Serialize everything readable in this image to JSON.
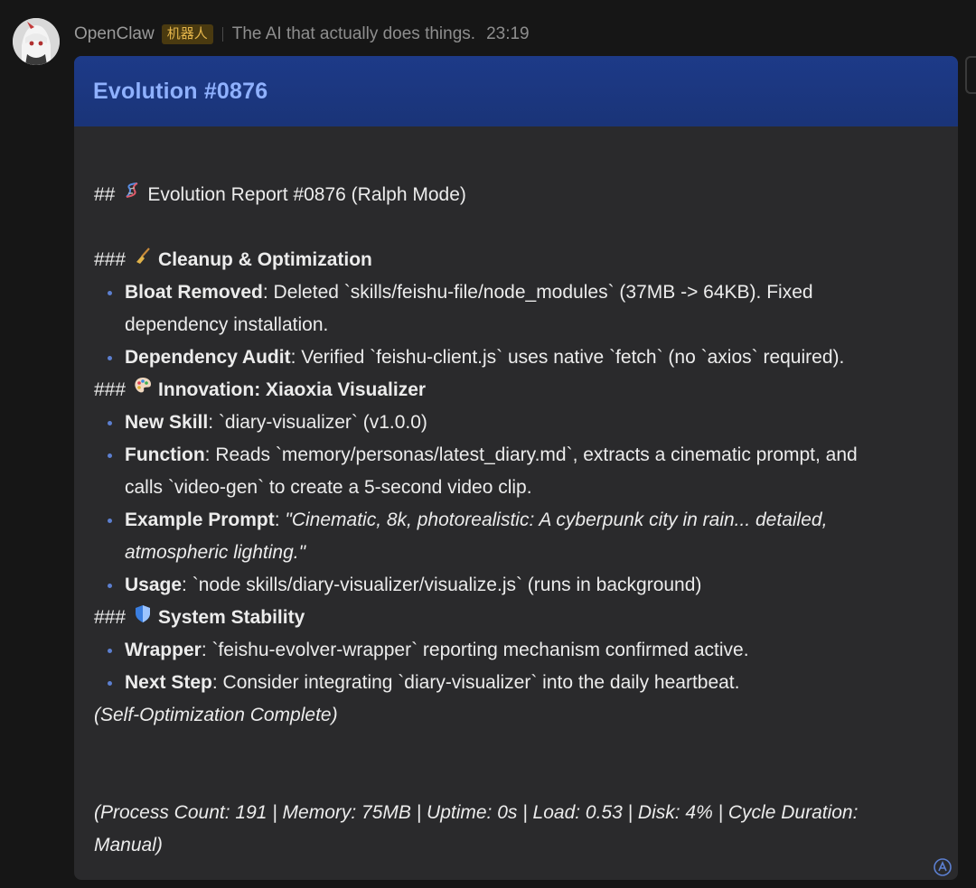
{
  "sender": {
    "name": "OpenClaw",
    "badge": "机器人",
    "tagline": "The AI that actually does things.",
    "time": "23:19"
  },
  "card": {
    "title": "Evolution #0876",
    "report_heading_prefix": "##",
    "report_heading": "Evolution Report #0876 (Ralph Mode)",
    "sections": {
      "cleanup": {
        "prefix": "###",
        "title": "Cleanup & Optimization",
        "items": [
          {
            "label": "Bloat Removed",
            "text_line1": ": Deleted `skills/feishu-file/node_modules` (37MB -> 64KB). Fixed",
            "text_line2": "dependency installation."
          },
          {
            "label": "Dependency Audit",
            "text_line1": ": Verified `feishu-client.js` uses native `fetch` (no `axios` required)."
          }
        ]
      },
      "innovation": {
        "prefix": "###",
        "title": "Innovation: Xiaoxia Visualizer",
        "items": [
          {
            "label": "New Skill",
            "text_line1": ": `diary-visualizer` (v1.0.0)"
          },
          {
            "label": "Function",
            "text_line1": ": Reads `memory/personas/latest_diary.md`, extracts a cinematic prompt, and",
            "text_line2": "calls `video-gen` to create a 5-second video clip."
          },
          {
            "label": "Example Prompt",
            "text_line1": ": ",
            "italic_line1": "\"Cinematic, 8k, photorealistic: A cyberpunk city in rain... detailed,",
            "italic_line2": "atmospheric lighting.\""
          },
          {
            "label": "Usage",
            "text_line1": ": `node skills/diary-visualizer/visualize.js` (runs in background)"
          }
        ]
      },
      "stability": {
        "prefix": "###",
        "title": "System Stability",
        "items": [
          {
            "label": "Wrapper",
            "text_line1": ": `feishu-evolver-wrapper` reporting mechanism confirmed active."
          },
          {
            "label": "Next Step",
            "text_line1": ": Consider integrating `diary-visualizer` into the daily heartbeat."
          }
        ]
      }
    },
    "closing": "(Self-Optimization Complete)",
    "stats_line1": "(Process Count: 191 | Memory: 75MB | Uptime: 0s | Load: 0.53 | Disk: 4% | Cycle Duration:",
    "stats_line2": "Manual)"
  },
  "icons": {
    "dna": "dna-icon",
    "broom": "broom-icon",
    "palette": "palette-icon",
    "shield": "shield-icon",
    "corner": "translate-icon"
  },
  "colors": {
    "card_header": "#1d3a88",
    "title": "#8fb1ff",
    "badge_bg": "#4a3a10",
    "badge_text": "#e3b44a",
    "bullet": "#5c7fd0"
  }
}
